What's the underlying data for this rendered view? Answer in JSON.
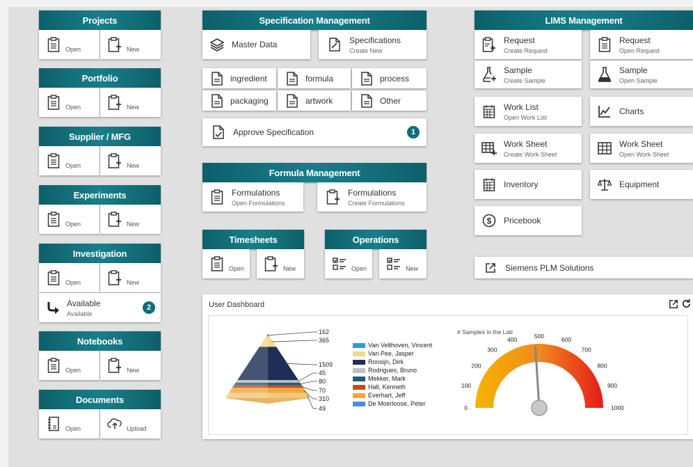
{
  "left": {
    "projects": {
      "title": "Projects",
      "open": "Open",
      "new": "New"
    },
    "portfolio": {
      "title": "Portfolio",
      "open": "Open",
      "new": "New"
    },
    "supplier": {
      "title": "Supplier / MFG",
      "open": "Open",
      "new": "New"
    },
    "experiments": {
      "title": "Experiments",
      "open": "Open",
      "new": "New"
    },
    "investigation": {
      "title": "Investigation",
      "open": "Open",
      "new": "New",
      "available_title": "Available",
      "available_sub": "Available",
      "available_count": "2"
    },
    "notebooks": {
      "title": "Notebooks",
      "open": "Open",
      "new": "New"
    },
    "documents": {
      "title": "Documents",
      "open": "Open",
      "upload": "Upload"
    }
  },
  "spec": {
    "title": "Specification Management",
    "master_data": "Master Data",
    "specifications": "Specifications",
    "specifications_sub": "Create New",
    "grid": [
      "ingredient",
      "formula",
      "process",
      "packaging",
      "artwork",
      "Other"
    ],
    "approve": "Approve Specification",
    "approve_count": "1"
  },
  "formula": {
    "title": "Formula Management",
    "open": "Formulations",
    "open_sub": "Open Formulations",
    "create": "Formulations",
    "create_sub": "Create Formulations"
  },
  "timesheets": {
    "title": "Timesheets",
    "open": "Open",
    "new": "New"
  },
  "operations": {
    "title": "Operations",
    "open": "Open",
    "new": "New"
  },
  "lims": {
    "title": "LIMS Management",
    "request_create": {
      "t1": "Request",
      "t2": "Create Request"
    },
    "request_open": {
      "t1": "Request",
      "t2": "Open Request"
    },
    "sample_create": {
      "t1": "Sample",
      "t2": "Create Sample"
    },
    "sample_open": {
      "t1": "Sample",
      "t2": "Open Sample"
    },
    "worklist": {
      "t1": "Work List",
      "t2": "Open Work List"
    },
    "charts": {
      "t1": "Charts"
    },
    "worksheet_create": {
      "t1": "Work Sheet",
      "t2": "Create Work Sheet"
    },
    "worksheet_open": {
      "t1": "Work Sheet",
      "t2": "Open Work Sheet"
    },
    "inventory": {
      "t1": "Inventory"
    },
    "equipment": {
      "t1": "Equipment"
    },
    "pricebook": {
      "t1": "Pricebook"
    }
  },
  "siemens": "Siemens PLM Solutions",
  "dashboard": {
    "title": "User Dashboard",
    "pyramid": {
      "labels": [
        "162",
        "365",
        "1509",
        "45",
        "80",
        "70",
        "310",
        "49"
      ],
      "legend": [
        {
          "name": "Van Velthoven, Vincent",
          "color": "#2a9fd6"
        },
        {
          "name": "Van Pee, Jasper",
          "color": "#f3d98c"
        },
        {
          "name": "Ronsijn, Dirk",
          "color": "#1d2f55"
        },
        {
          "name": "Rodrigues, Bruno",
          "color": "#bfbfbf"
        },
        {
          "name": "Mekker, Mark",
          "color": "#1e5f7a"
        },
        {
          "name": "Hall, Kenneth",
          "color": "#c84a1c"
        },
        {
          "name": "Everhart, Jeff",
          "color": "#f0a83c"
        },
        {
          "name": "De Moerloose, Peter",
          "color": "#4a90d9"
        }
      ]
    },
    "gauge": {
      "title": "# Samples in the Lab",
      "ticks": [
        "0",
        "100",
        "200",
        "300",
        "400",
        "500",
        "600",
        "700",
        "800",
        "900",
        "1000"
      ],
      "value": 480
    }
  }
}
